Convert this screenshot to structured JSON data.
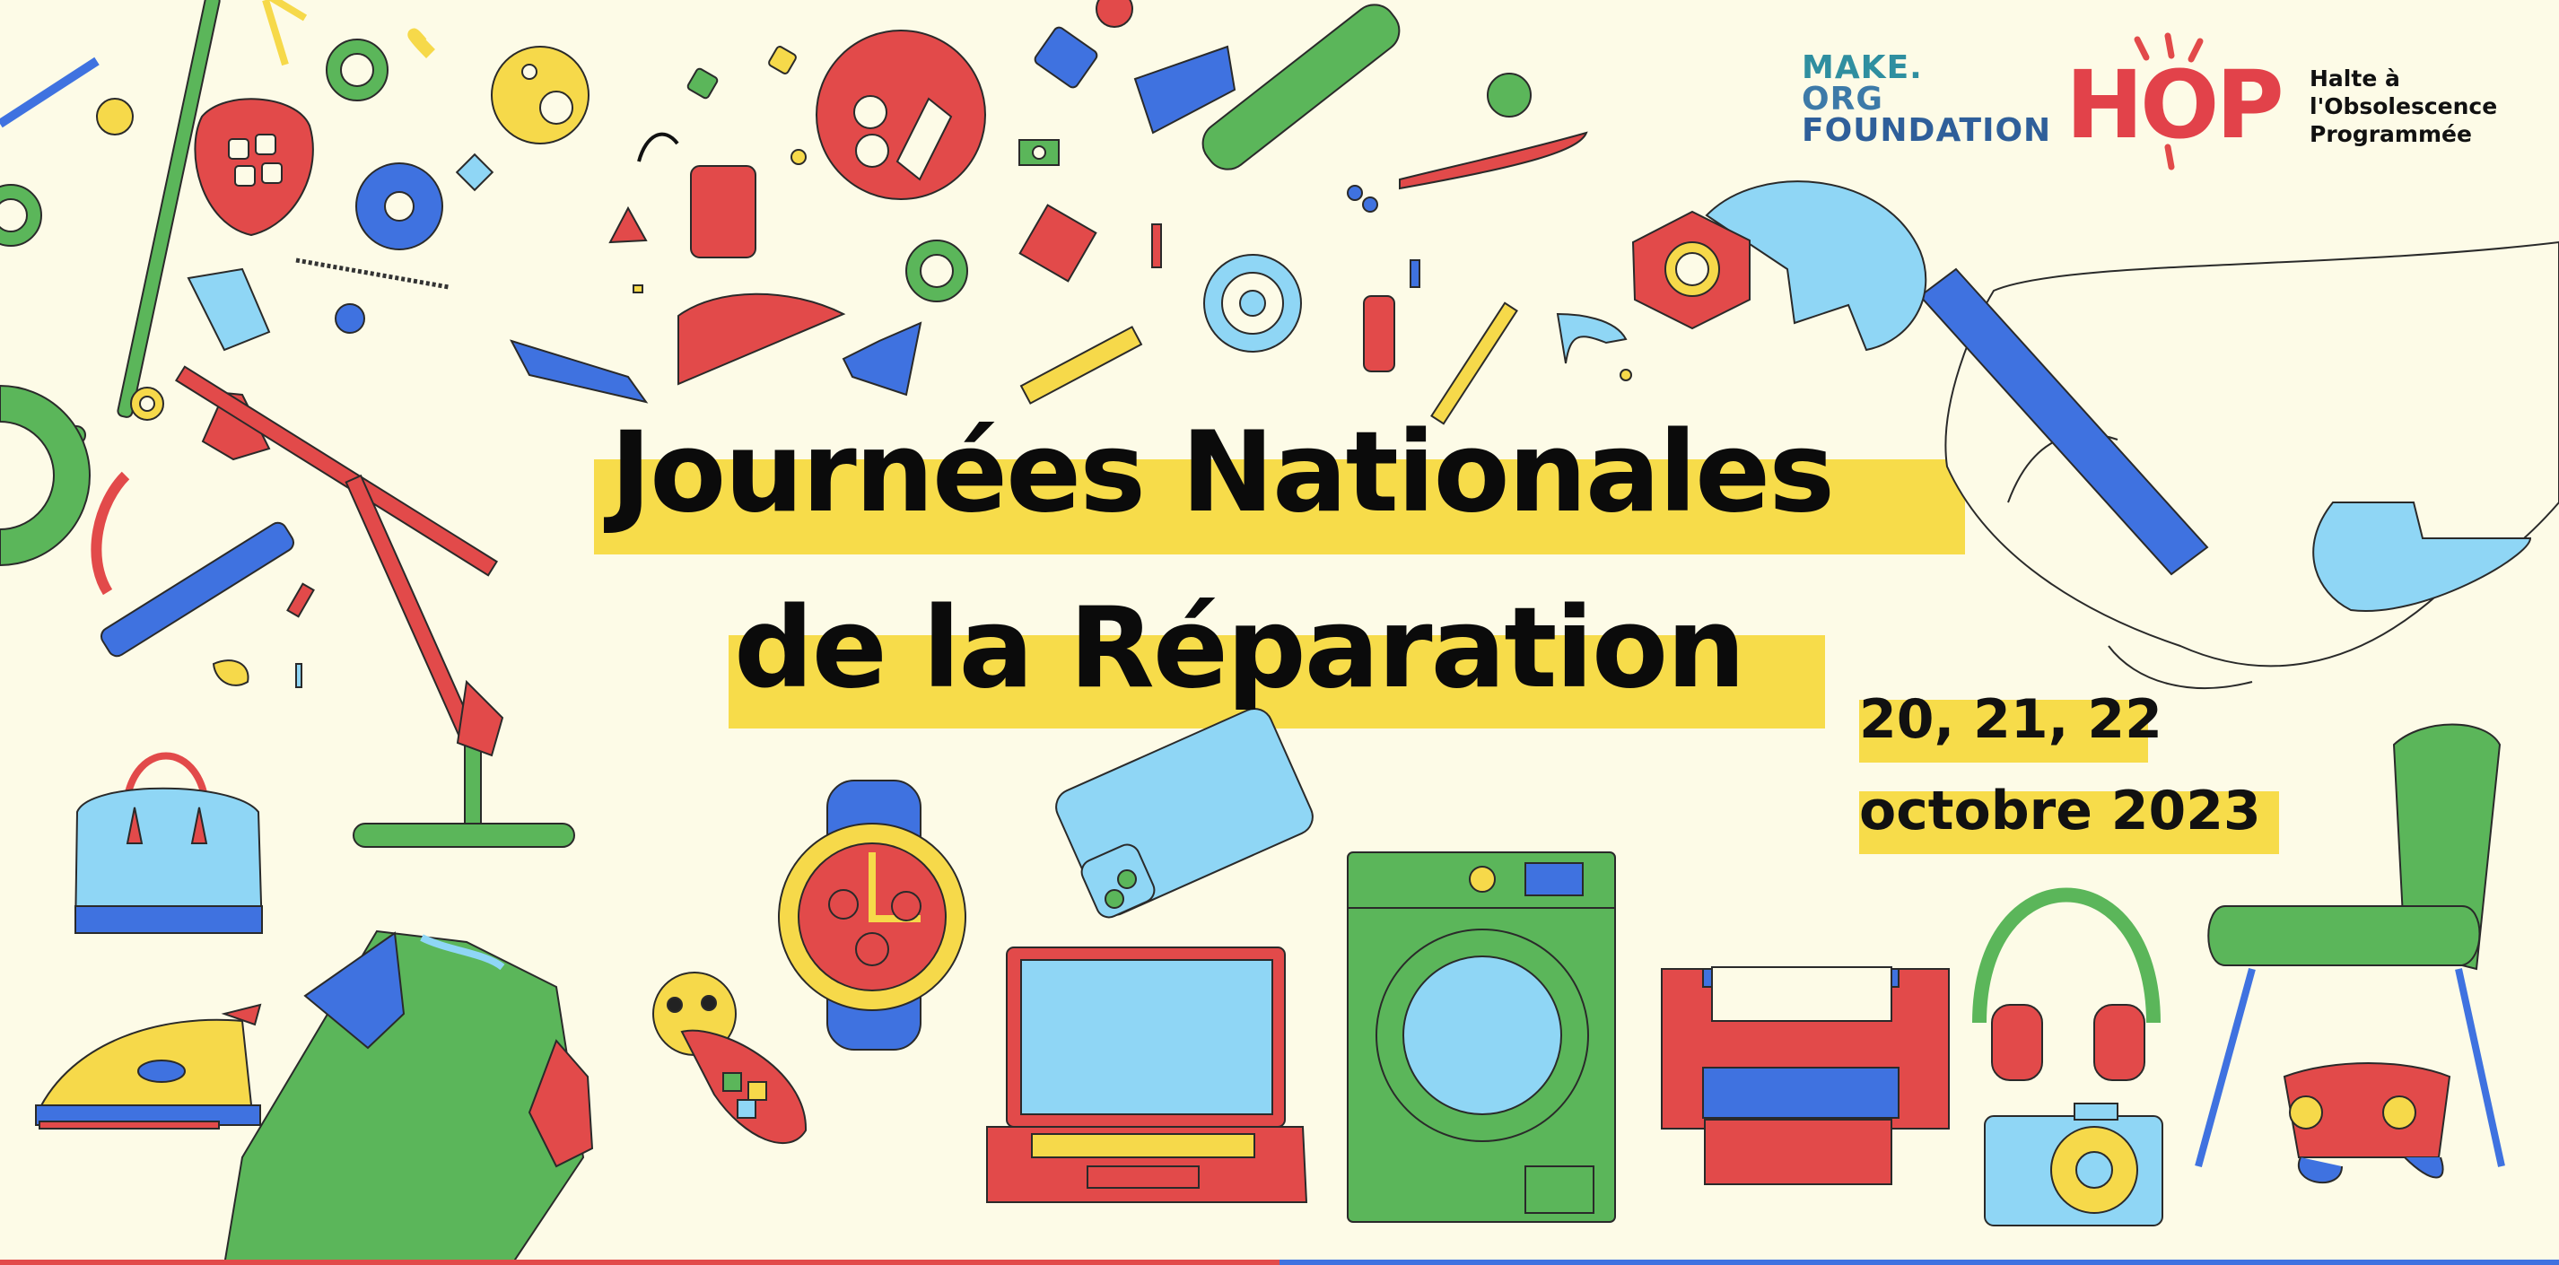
{
  "poster": {
    "title_line1": "Journées Nationales",
    "title_line2": "de la Réparation",
    "date_line1": "20, 21, 22",
    "date_line2": "octobre 2023"
  },
  "logos": {
    "make_org": [
      "MAKE.",
      "ORG",
      "FOUNDATION"
    ],
    "hop_word": "HOP",
    "hop_tagline": [
      "Halte à",
      "l'Obsolescence",
      "Programmée"
    ]
  },
  "colors": {
    "background": "#fdfbe7",
    "highlight": "#f7dc4a",
    "red": "#e24a4a",
    "green": "#5bb65a",
    "blue": "#3f72e0",
    "light_blue": "#8fd6f5",
    "yellow": "#f6d94a"
  },
  "illustrations": [
    "wrench-icon",
    "hand-icon",
    "desk-lamp-icon",
    "handbag-icon",
    "iron-icon",
    "tshirt-icon",
    "watch-icon",
    "smartphone-icon",
    "toy-phone-icon",
    "laptop-icon",
    "washing-machine-icon",
    "printer-icon",
    "headphones-icon",
    "camera-icon",
    "chair-icon",
    "game-controller-icon",
    "confetti-shapes"
  ]
}
